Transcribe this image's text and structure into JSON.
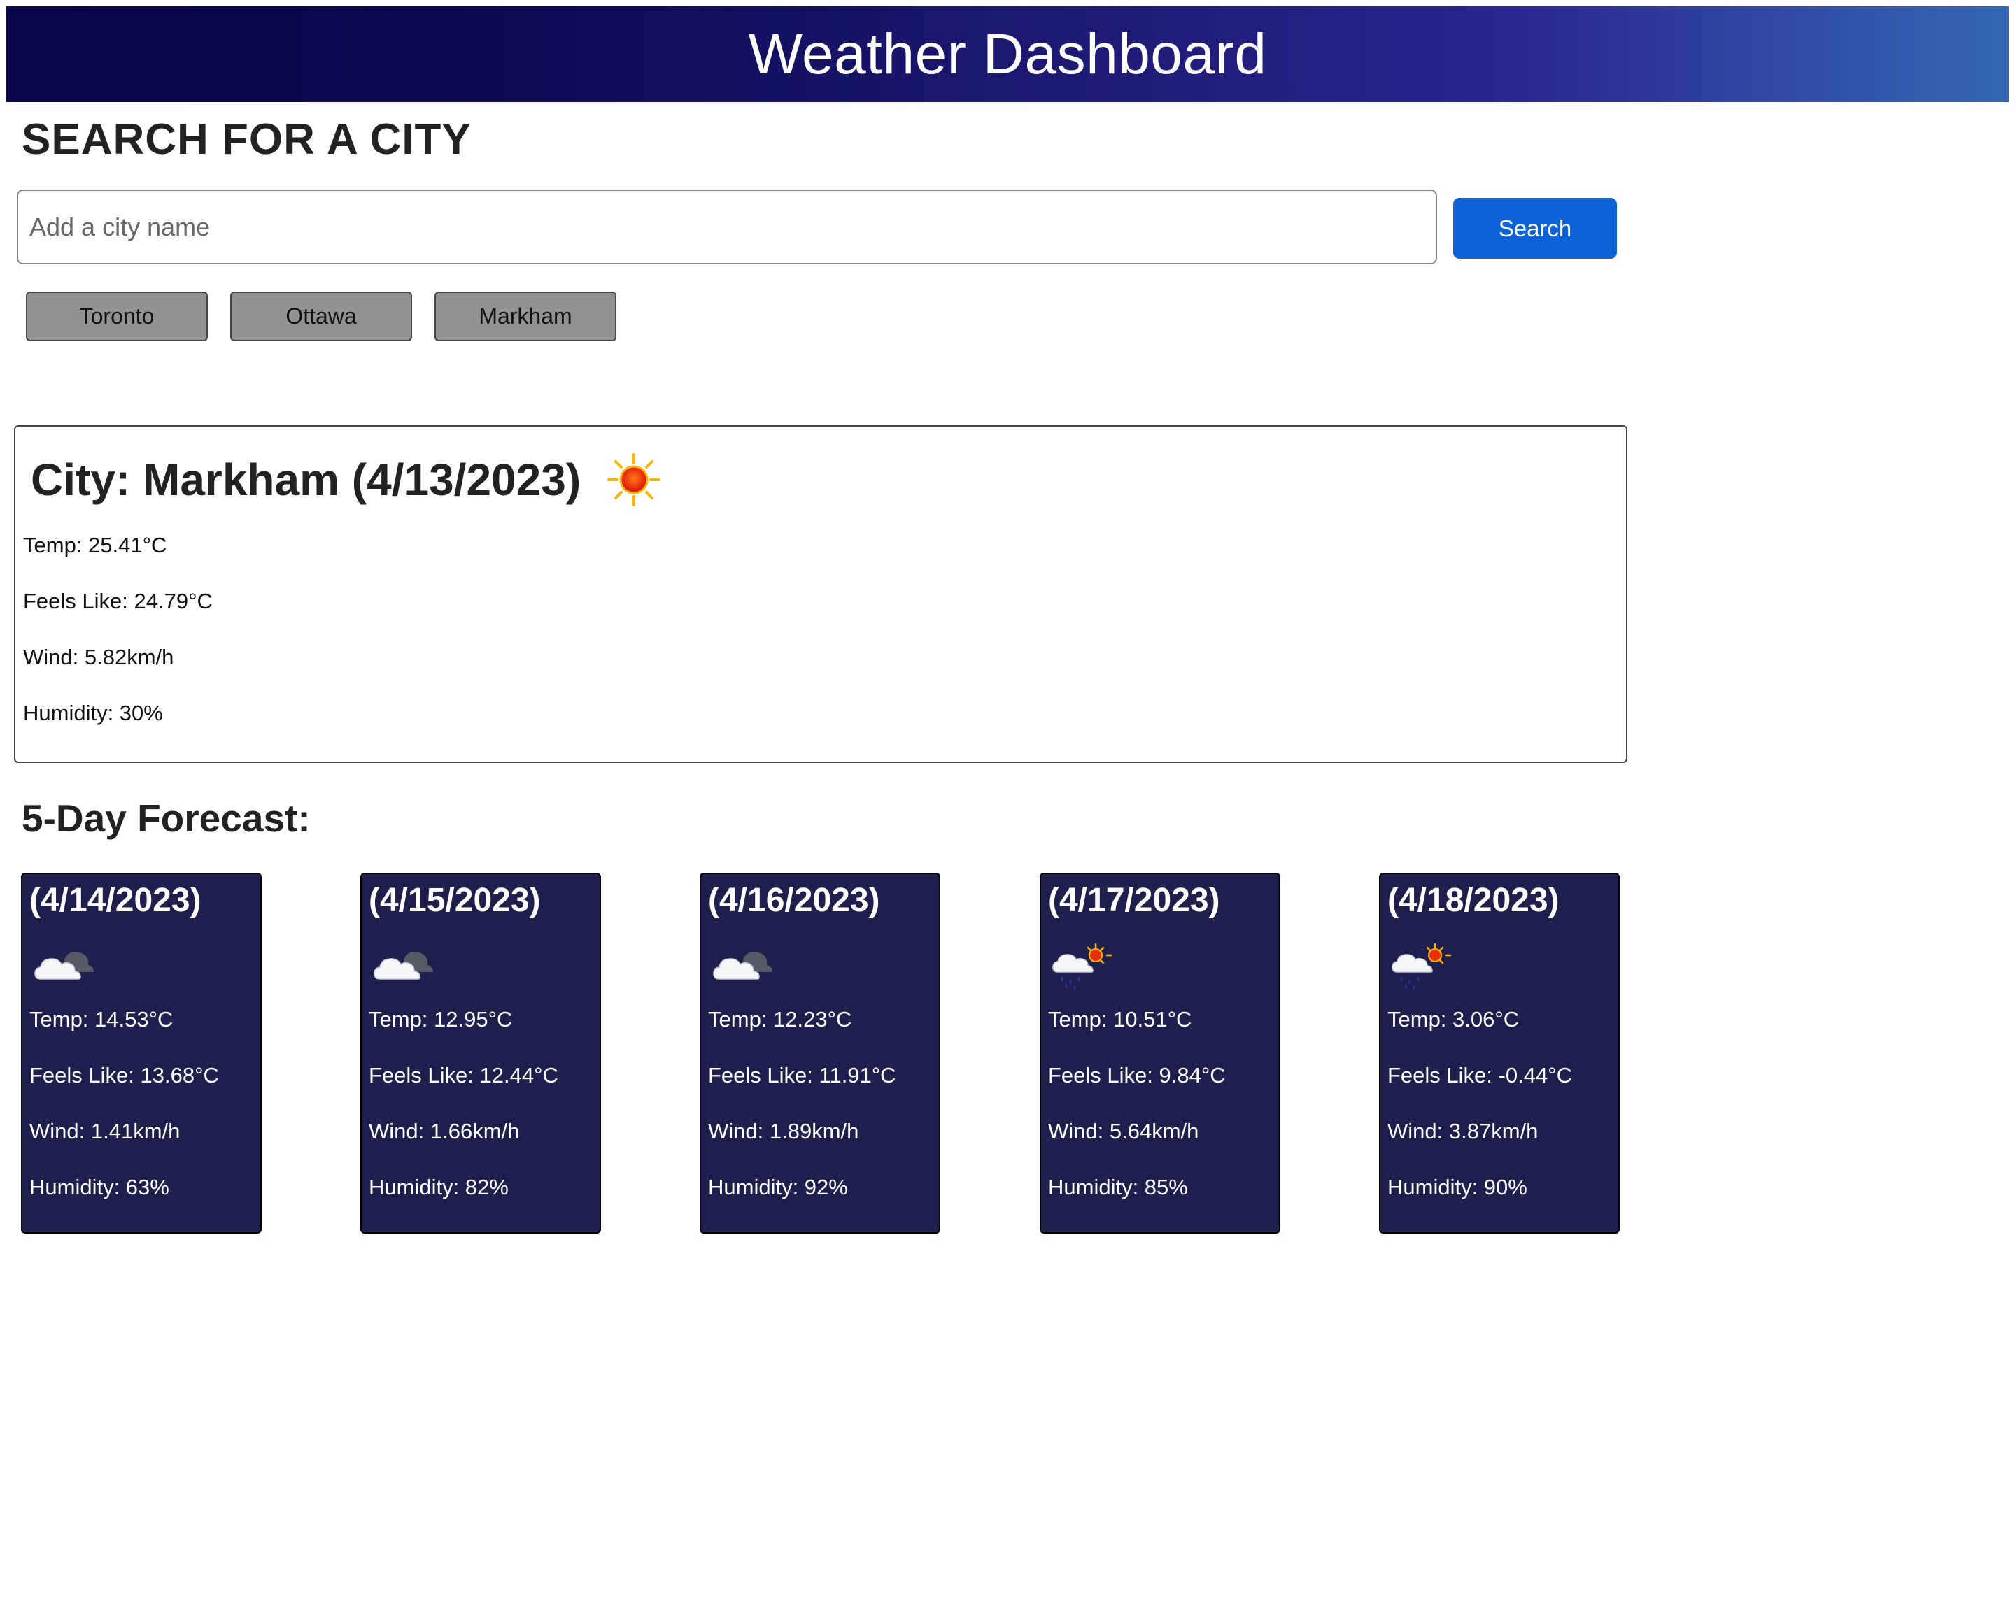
{
  "header": {
    "title": "Weather Dashboard"
  },
  "search": {
    "heading": "SEARCH FOR A CITY",
    "placeholder": "Add a city name",
    "value": "",
    "button_label": "Search"
  },
  "history": {
    "items": [
      {
        "label": "Toronto"
      },
      {
        "label": "Ottawa"
      },
      {
        "label": "Markham"
      }
    ]
  },
  "current": {
    "title": "City: Markham (4/13/2023)",
    "icon": "sun-icon",
    "temp": "Temp: 25.41°C",
    "feels_like": "Feels Like: 24.79°C",
    "wind": "Wind: 5.82km/h",
    "humidity": "Humidity: 30%"
  },
  "forecast": {
    "heading": "5-Day Forecast:",
    "days": [
      {
        "date": "(4/14/2023)",
        "icon": "cloudy-icon",
        "temp": "Temp: 14.53°C",
        "feels_like": "Feels Like: 13.68°C",
        "wind": "Wind: 1.41km/h",
        "humidity": "Humidity: 63%"
      },
      {
        "date": "(4/15/2023)",
        "icon": "cloudy-icon",
        "temp": "Temp: 12.95°C",
        "feels_like": "Feels Like: 12.44°C",
        "wind": "Wind: 1.66km/h",
        "humidity": "Humidity: 82%"
      },
      {
        "date": "(4/16/2023)",
        "icon": "cloudy-icon",
        "temp": "Temp: 12.23°C",
        "feels_like": "Feels Like: 11.91°C",
        "wind": "Wind: 1.89km/h",
        "humidity": "Humidity: 92%"
      },
      {
        "date": "(4/17/2023)",
        "icon": "rain-sun-icon",
        "temp": "Temp: 10.51°C",
        "feels_like": "Feels Like: 9.84°C",
        "wind": "Wind: 5.64km/h",
        "humidity": "Humidity: 85%"
      },
      {
        "date": "(4/18/2023)",
        "icon": "rain-sun-icon",
        "temp": "Temp: 3.06°C",
        "feels_like": "Feels Like: -0.44°C",
        "wind": "Wind: 3.87km/h",
        "humidity": "Humidity: 90%"
      }
    ]
  },
  "colors": {
    "header_gradient_start": "#090748",
    "header_gradient_end": "#3567b5",
    "search_button": "#0d62d8",
    "history_button": "#939393",
    "forecast_card": "#1f1f4e"
  }
}
